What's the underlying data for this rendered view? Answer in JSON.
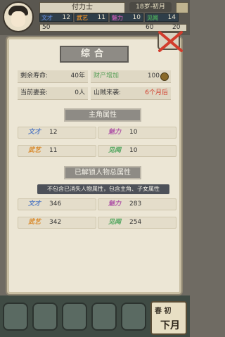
{
  "header": {
    "name": "付力士",
    "date": "18岁-初月",
    "stats": [
      {
        "icon_text": "文才",
        "value": "12",
        "color": "#5b7fc2"
      },
      {
        "icon_text": "武艺",
        "value": "11",
        "color": "#d98a2c"
      },
      {
        "icon_text": "魅力",
        "value": "10",
        "color": "#b15aa8"
      },
      {
        "icon_text": "见闻",
        "value": "14",
        "color": "#4aa35a"
      }
    ],
    "row3": {
      "tag": "50",
      "val1": "60",
      "val2": "20"
    }
  },
  "panel": {
    "title": "综合",
    "info": [
      {
        "label": "剩余寿命:",
        "value": "40年",
        "value_color": "#3a3a3a"
      },
      {
        "label": "财产增加",
        "value": "100",
        "value_color": "#3a3a3a",
        "label_color": "#5aa05a"
      },
      {
        "label": "当前妻妾:",
        "value": "0人",
        "value_color": "#3a3a3a"
      },
      {
        "label": "山贼来袭:",
        "value": "6个月后",
        "value_color": "#d23c2c"
      }
    ],
    "section1": {
      "title": "主角属性",
      "attrs": [
        {
          "icon": "文才",
          "value": "12",
          "color": "#5b7fc2"
        },
        {
          "icon": "魅力",
          "value": "10",
          "color": "#b15aa8"
        },
        {
          "icon": "武艺",
          "value": "11",
          "color": "#d98a2c"
        },
        {
          "icon": "见闻",
          "value": "10",
          "color": "#4aa35a"
        }
      ]
    },
    "section2": {
      "title": "已解锁人物总属性",
      "note": "不包含已消失人物属性，包含主角、子女属性",
      "attrs": [
        {
          "icon": "文才",
          "value": "346",
          "color": "#5b7fc2"
        },
        {
          "icon": "魅力",
          "value": "283",
          "color": "#b15aa8"
        },
        {
          "icon": "武艺",
          "value": "342",
          "color": "#d98a2c"
        },
        {
          "icon": "见闻",
          "value": "254",
          "color": "#4aa35a"
        }
      ]
    }
  },
  "bottom": {
    "next_label": "下月",
    "next_sub": "春 初"
  }
}
